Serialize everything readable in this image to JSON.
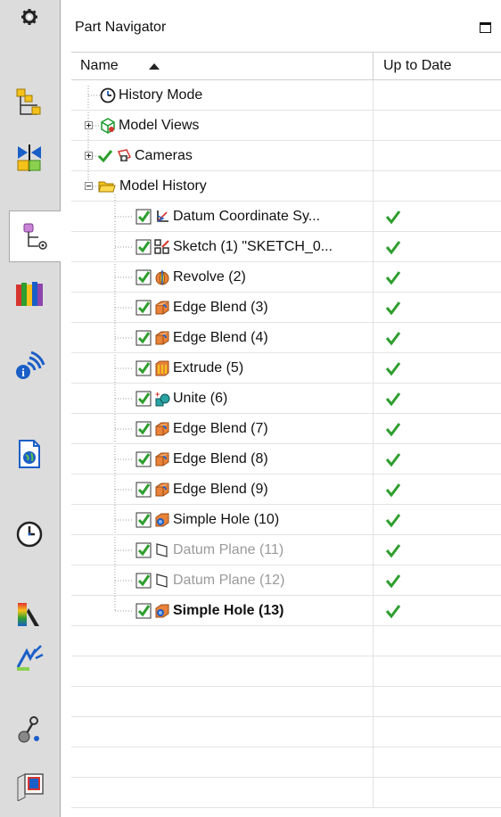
{
  "panel": {
    "title": "Part Navigator"
  },
  "header": {
    "col_name": "Name",
    "col_uptodate": "Up to Date"
  },
  "sidebar": {
    "items": [
      {
        "name": "settings-gear-icon"
      },
      {
        "name": "assembly-navigator-icon"
      },
      {
        "name": "constraint-navigator-icon"
      },
      {
        "name": "part-navigator-icon",
        "active": true
      },
      {
        "name": "reuse-library-icon"
      },
      {
        "name": "roles-icon"
      },
      {
        "name": "web-browser-icon"
      },
      {
        "name": "history-icon"
      },
      {
        "name": "visualization-icon"
      },
      {
        "name": "process-studio-icon"
      },
      {
        "name": "system-materials-icon"
      },
      {
        "name": "palettes-icon"
      }
    ]
  },
  "tree": [
    {
      "label": "History Mode",
      "icon": "clock-icon",
      "level": 0
    },
    {
      "label": "Model Views",
      "icon": "model-views-icon",
      "level": 0,
      "expander": "plus"
    },
    {
      "label": "Cameras",
      "icon": "camera-icon",
      "level": 0,
      "expander": "plus",
      "checkmark": true
    },
    {
      "label": "Model History",
      "icon": "folder-icon",
      "level": 0,
      "expander": "minus"
    },
    {
      "label": "Datum Coordinate Sy...",
      "icon": "datum-csys-icon",
      "level": 1,
      "checked": true,
      "uptodate": true
    },
    {
      "label": "Sketch (1) \"SKETCH_0...",
      "icon": "sketch-icon",
      "level": 1,
      "checked": true,
      "uptodate": true
    },
    {
      "label": "Revolve (2)",
      "icon": "revolve-icon",
      "level": 1,
      "checked": true,
      "uptodate": true
    },
    {
      "label": "Edge Blend (3)",
      "icon": "edge-blend-icon",
      "level": 1,
      "checked": true,
      "uptodate": true
    },
    {
      "label": "Edge Blend (4)",
      "icon": "edge-blend-icon",
      "level": 1,
      "checked": true,
      "uptodate": true
    },
    {
      "label": "Extrude (5)",
      "icon": "extrude-icon",
      "level": 1,
      "checked": true,
      "uptodate": true
    },
    {
      "label": "Unite (6)",
      "icon": "unite-icon",
      "level": 1,
      "checked": true,
      "uptodate": true
    },
    {
      "label": "Edge Blend (7)",
      "icon": "edge-blend-icon",
      "level": 1,
      "checked": true,
      "uptodate": true
    },
    {
      "label": "Edge Blend (8)",
      "icon": "edge-blend-icon",
      "level": 1,
      "checked": true,
      "uptodate": true
    },
    {
      "label": "Edge Blend (9)",
      "icon": "edge-blend-icon",
      "level": 1,
      "checked": true,
      "uptodate": true
    },
    {
      "label": "Simple Hole (10)",
      "icon": "simple-hole-icon",
      "level": 1,
      "checked": true,
      "uptodate": true
    },
    {
      "label": "Datum Plane (11)",
      "icon": "datum-plane-icon",
      "level": 1,
      "checked": true,
      "uptodate": true,
      "dim": true
    },
    {
      "label": "Datum Plane (12)",
      "icon": "datum-plane-icon",
      "level": 1,
      "checked": true,
      "uptodate": true,
      "dim": true
    },
    {
      "label": "Simple Hole (13)",
      "icon": "simple-hole-icon",
      "level": 1,
      "checked": true,
      "uptodate": true,
      "bold": true
    }
  ],
  "colors": {
    "check_green": "#2e9e2e",
    "selection_border": "#a8a8a8",
    "sidebar_bg": "#dcdcdc"
  }
}
